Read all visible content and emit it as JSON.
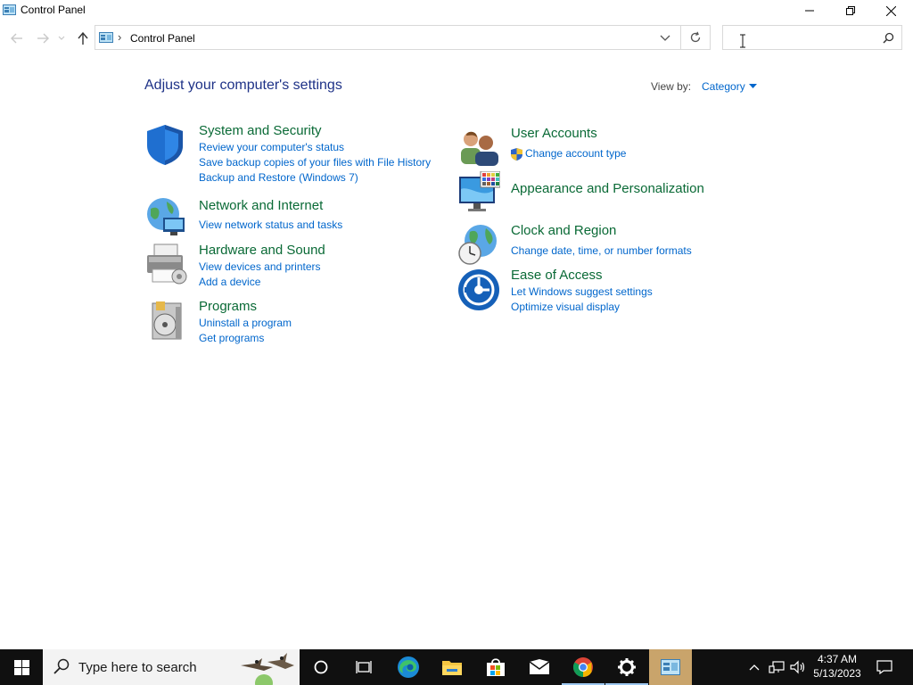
{
  "window": {
    "title": "Control Panel",
    "buttons": [
      "minimize-button",
      "restore-button",
      "close-button"
    ]
  },
  "address_bar": {
    "path": "Control Panel",
    "separator": "›",
    "search_placeholder": ""
  },
  "main": {
    "heading": "Adjust your computer's settings",
    "view_by_label": "View by:",
    "view_by_value": "Category",
    "categories": [
      {
        "title": "System and Security",
        "icon": "shield-icon",
        "links": [
          "Review your computer's status",
          "Save backup copies of your files with File History",
          "Backup and Restore (Windows 7)"
        ]
      },
      {
        "title": "Network and Internet",
        "icon": "network-globe-icon",
        "links": [
          "View network status and tasks"
        ]
      },
      {
        "title": "Hardware and Sound",
        "icon": "printer-icon",
        "links": [
          "View devices and printers",
          "Add a device"
        ]
      },
      {
        "title": "Programs",
        "icon": "programs-disc-icon",
        "links": [
          "Uninstall a program",
          "Get programs"
        ]
      },
      {
        "title": "User Accounts",
        "icon": "users-icon",
        "links": [
          "Change account type"
        ]
      },
      {
        "title": "Appearance and Personalization",
        "icon": "monitor-palette-icon",
        "links": []
      },
      {
        "title": "Clock and Region",
        "icon": "clock-globe-icon",
        "links": [
          "Change date, time, or number formats"
        ]
      },
      {
        "title": "Ease of Access",
        "icon": "ease-of-access-icon",
        "links": [
          "Let Windows suggest settings",
          "Optimize visual display"
        ]
      }
    ]
  },
  "taskbar": {
    "search_placeholder": "Type here to search",
    "time": "4:37 AM",
    "date": "5/13/2023",
    "apps": [
      "cortana-icon",
      "task-view-icon",
      "edge-icon",
      "file-explorer-icon",
      "store-icon",
      "mail-icon",
      "chrome-icon",
      "settings-icon",
      "control-panel-icon"
    ]
  },
  "colors": {
    "heading": "#1e3287",
    "category_title": "#0a6a36",
    "link": "#0066cc",
    "taskbar": "#101010"
  }
}
